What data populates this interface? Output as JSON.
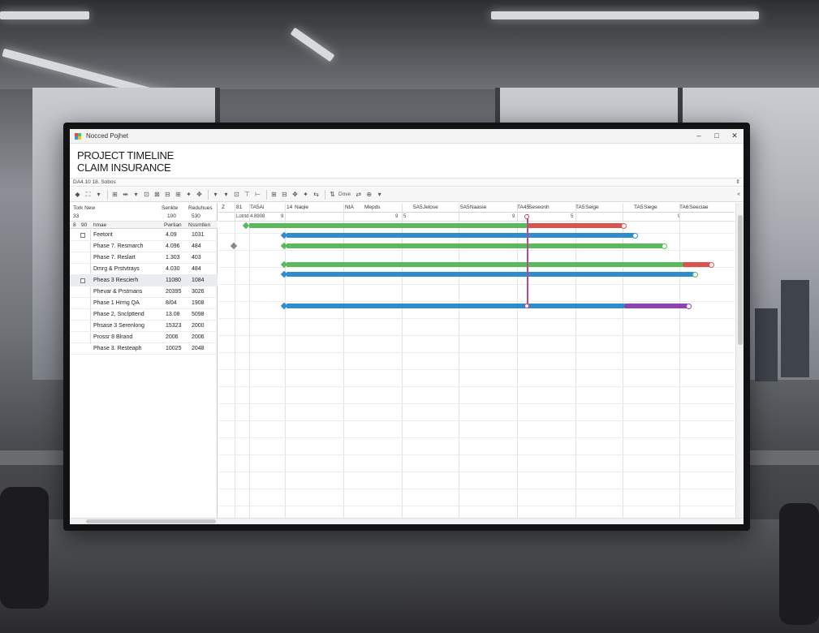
{
  "window": {
    "title": "Nocced Pojhet",
    "controls": {
      "minimize": "–",
      "maximize": "□",
      "close": "✕"
    }
  },
  "heading": {
    "line1": "PROJECT TIMELINE",
    "line2": "CLAIM INSURANCE"
  },
  "subbar": {
    "text": "DA4.10  18. Sobos",
    "scroll_arrow": "⇕"
  },
  "toolbar": {
    "icons": [
      "◆",
      "⛶",
      "▾",
      "⊞",
      "⇹",
      "▾",
      "⊡",
      "⊠",
      "⊟",
      "⊞",
      "✦",
      "✥",
      "▾",
      "▾",
      "⊡",
      "⊤",
      "⊢",
      "⊞",
      "⊟",
      "✥",
      "✦",
      "⇆",
      "⇅",
      "⇄",
      "⊕",
      "▾"
    ],
    "labels": {
      "move": "Dove"
    },
    "end": "«"
  },
  "table": {
    "header_top": {
      "col0": "Tork New",
      "col1": "Senkte",
      "col2": "Reduhues"
    },
    "header_sub": {
      "col0": "33",
      "col1": "100",
      "col2": "530"
    },
    "header_cols": {
      "idx": "8",
      "mark": "90",
      "name": "hmae",
      "c1": "Pwrtian",
      "c2": "Nssmtlen"
    },
    "rows": [
      {
        "name": "Feetorit",
        "c1": "4.09",
        "c2": "1031",
        "checkbox": true,
        "selected": false
      },
      {
        "name": "Phase 7. Resmarch",
        "c1": "4.096",
        "c2": "484",
        "checkbox": false,
        "selected": false
      },
      {
        "name": "Phase 7. Reslart",
        "c1": "1.303",
        "c2": "403",
        "checkbox": false,
        "selected": false
      },
      {
        "name": "Dmrg & Prstvtrays",
        "c1": "4.030",
        "c2": "484",
        "checkbox": false,
        "selected": false
      },
      {
        "name": "Pheas 3 Rescierh",
        "c1": "11080",
        "c2": "1084",
        "checkbox": true,
        "selected": true
      },
      {
        "name": "Phevar & Prstmans",
        "c1": "20395",
        "c2": "3026",
        "checkbox": false,
        "selected": false
      },
      {
        "name": "Phase 1 Hrmg QA",
        "c1": "8/04",
        "c2": "1908",
        "checkbox": false,
        "selected": false
      },
      {
        "name": "Phase 2, Snclpttend",
        "c1": "13.08",
        "c2": "5098",
        "checkbox": false,
        "selected": false
      },
      {
        "name": "Phsase 3 Serenlong",
        "c1": "15323",
        "c2": "2000",
        "checkbox": false,
        "selected": false
      },
      {
        "name": "Prossr 8 Blrand",
        "c1": "2006",
        "c2": "2006",
        "checkbox": false,
        "selected": false
      },
      {
        "name": "Phase 3. Resteaph",
        "c1": "10025",
        "c2": "2048",
        "checkbox": false,
        "selected": false
      }
    ]
  },
  "gantt": {
    "header": [
      "Z",
      "81",
      "TA5Ai",
      "14",
      "Naqie",
      "NtA",
      "Mepds",
      "5A5",
      "Jelose",
      "5A5",
      "Naasie",
      "TA45",
      "Seseonh",
      "TA5",
      "Seige",
      "TA5",
      "Siege",
      "TA6",
      "Seeciae"
    ],
    "subheader": {
      "task": "Lotrtd 4.8908",
      "m1": "9",
      "m2": "9",
      "m3": "5",
      "m4": "9",
      "m5": "5",
      "m6": "9"
    },
    "colors": {
      "green": "#5cb85c",
      "blue": "#2e8dcf",
      "red": "#d9534f",
      "purple": "#8e44ad",
      "today": "#b44b8c"
    }
  }
}
